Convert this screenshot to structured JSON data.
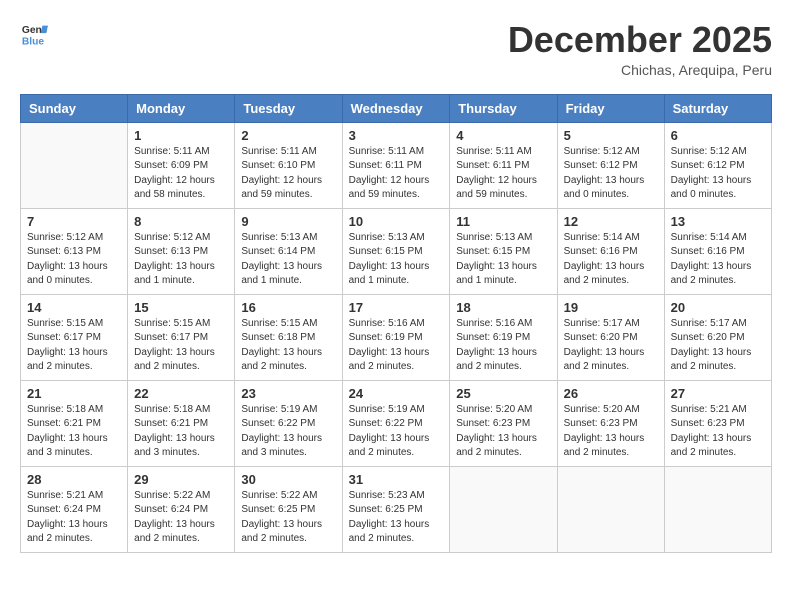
{
  "header": {
    "logo_general": "General",
    "logo_blue": "Blue",
    "month": "December 2025",
    "location": "Chichas, Arequipa, Peru"
  },
  "days_of_week": [
    "Sunday",
    "Monday",
    "Tuesday",
    "Wednesday",
    "Thursday",
    "Friday",
    "Saturday"
  ],
  "weeks": [
    [
      {
        "day": "",
        "info": ""
      },
      {
        "day": "1",
        "info": "Sunrise: 5:11 AM\nSunset: 6:09 PM\nDaylight: 12 hours\nand 58 minutes."
      },
      {
        "day": "2",
        "info": "Sunrise: 5:11 AM\nSunset: 6:10 PM\nDaylight: 12 hours\nand 59 minutes."
      },
      {
        "day": "3",
        "info": "Sunrise: 5:11 AM\nSunset: 6:11 PM\nDaylight: 12 hours\nand 59 minutes."
      },
      {
        "day": "4",
        "info": "Sunrise: 5:11 AM\nSunset: 6:11 PM\nDaylight: 12 hours\nand 59 minutes."
      },
      {
        "day": "5",
        "info": "Sunrise: 5:12 AM\nSunset: 6:12 PM\nDaylight: 13 hours\nand 0 minutes."
      },
      {
        "day": "6",
        "info": "Sunrise: 5:12 AM\nSunset: 6:12 PM\nDaylight: 13 hours\nand 0 minutes."
      }
    ],
    [
      {
        "day": "7",
        "info": "Sunrise: 5:12 AM\nSunset: 6:13 PM\nDaylight: 13 hours\nand 0 minutes."
      },
      {
        "day": "8",
        "info": "Sunrise: 5:12 AM\nSunset: 6:13 PM\nDaylight: 13 hours\nand 1 minute."
      },
      {
        "day": "9",
        "info": "Sunrise: 5:13 AM\nSunset: 6:14 PM\nDaylight: 13 hours\nand 1 minute."
      },
      {
        "day": "10",
        "info": "Sunrise: 5:13 AM\nSunset: 6:15 PM\nDaylight: 13 hours\nand 1 minute."
      },
      {
        "day": "11",
        "info": "Sunrise: 5:13 AM\nSunset: 6:15 PM\nDaylight: 13 hours\nand 1 minute."
      },
      {
        "day": "12",
        "info": "Sunrise: 5:14 AM\nSunset: 6:16 PM\nDaylight: 13 hours\nand 2 minutes."
      },
      {
        "day": "13",
        "info": "Sunrise: 5:14 AM\nSunset: 6:16 PM\nDaylight: 13 hours\nand 2 minutes."
      }
    ],
    [
      {
        "day": "14",
        "info": "Sunrise: 5:15 AM\nSunset: 6:17 PM\nDaylight: 13 hours\nand 2 minutes."
      },
      {
        "day": "15",
        "info": "Sunrise: 5:15 AM\nSunset: 6:17 PM\nDaylight: 13 hours\nand 2 minutes."
      },
      {
        "day": "16",
        "info": "Sunrise: 5:15 AM\nSunset: 6:18 PM\nDaylight: 13 hours\nand 2 minutes."
      },
      {
        "day": "17",
        "info": "Sunrise: 5:16 AM\nSunset: 6:19 PM\nDaylight: 13 hours\nand 2 minutes."
      },
      {
        "day": "18",
        "info": "Sunrise: 5:16 AM\nSunset: 6:19 PM\nDaylight: 13 hours\nand 2 minutes."
      },
      {
        "day": "19",
        "info": "Sunrise: 5:17 AM\nSunset: 6:20 PM\nDaylight: 13 hours\nand 2 minutes."
      },
      {
        "day": "20",
        "info": "Sunrise: 5:17 AM\nSunset: 6:20 PM\nDaylight: 13 hours\nand 2 minutes."
      }
    ],
    [
      {
        "day": "21",
        "info": "Sunrise: 5:18 AM\nSunset: 6:21 PM\nDaylight: 13 hours\nand 3 minutes."
      },
      {
        "day": "22",
        "info": "Sunrise: 5:18 AM\nSunset: 6:21 PM\nDaylight: 13 hours\nand 3 minutes."
      },
      {
        "day": "23",
        "info": "Sunrise: 5:19 AM\nSunset: 6:22 PM\nDaylight: 13 hours\nand 3 minutes."
      },
      {
        "day": "24",
        "info": "Sunrise: 5:19 AM\nSunset: 6:22 PM\nDaylight: 13 hours\nand 2 minutes."
      },
      {
        "day": "25",
        "info": "Sunrise: 5:20 AM\nSunset: 6:23 PM\nDaylight: 13 hours\nand 2 minutes."
      },
      {
        "day": "26",
        "info": "Sunrise: 5:20 AM\nSunset: 6:23 PM\nDaylight: 13 hours\nand 2 minutes."
      },
      {
        "day": "27",
        "info": "Sunrise: 5:21 AM\nSunset: 6:23 PM\nDaylight: 13 hours\nand 2 minutes."
      }
    ],
    [
      {
        "day": "28",
        "info": "Sunrise: 5:21 AM\nSunset: 6:24 PM\nDaylight: 13 hours\nand 2 minutes."
      },
      {
        "day": "29",
        "info": "Sunrise: 5:22 AM\nSunset: 6:24 PM\nDaylight: 13 hours\nand 2 minutes."
      },
      {
        "day": "30",
        "info": "Sunrise: 5:22 AM\nSunset: 6:25 PM\nDaylight: 13 hours\nand 2 minutes."
      },
      {
        "day": "31",
        "info": "Sunrise: 5:23 AM\nSunset: 6:25 PM\nDaylight: 13 hours\nand 2 minutes."
      },
      {
        "day": "",
        "info": ""
      },
      {
        "day": "",
        "info": ""
      },
      {
        "day": "",
        "info": ""
      }
    ]
  ]
}
